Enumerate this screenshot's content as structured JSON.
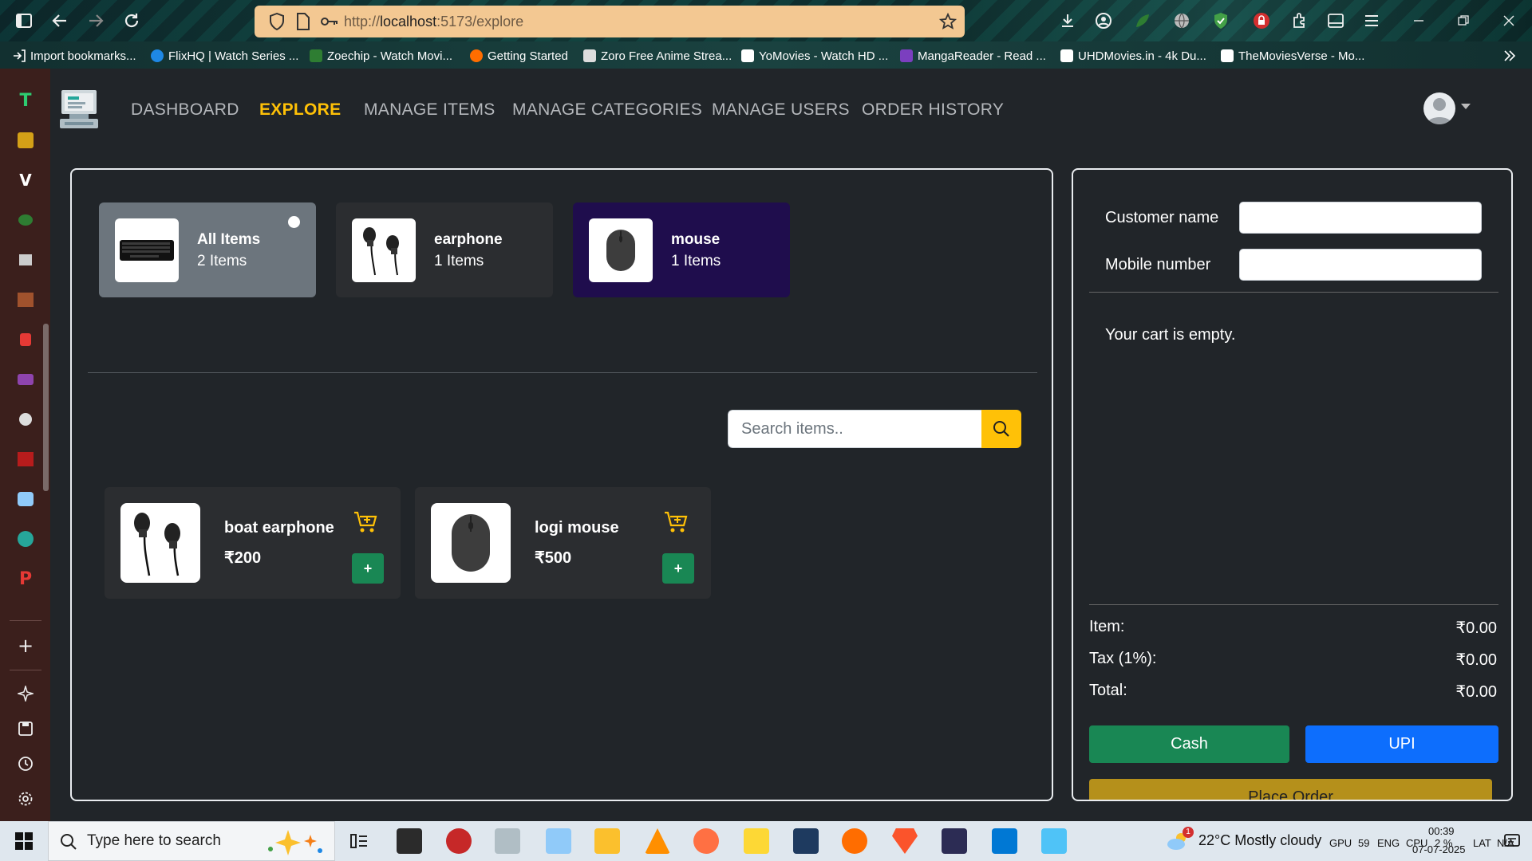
{
  "browser": {
    "url_prefix": "http://",
    "url_host": "localhost",
    "url_rest": ":5173/explore",
    "bookmarks": [
      "Import bookmarks...",
      "FlixHQ | Watch Series ...",
      "Zoechip - Watch Movi...",
      "Getting Started",
      "Zoro Free Anime Strea...",
      "YoMovies - Watch HD ...",
      "MangaReader - Read ...",
      "UHDMovies.in - 4k Du...",
      "TheMoviesVerse - Mo..."
    ]
  },
  "nav": {
    "links": [
      "DASHBOARD",
      "EXPLORE",
      "MANAGE ITEMS",
      "MANAGE CATEGORIES",
      "MANAGE USERS",
      "ORDER HISTORY"
    ],
    "active": "EXPLORE"
  },
  "categories": [
    {
      "name": "All Items",
      "count": "2 Items",
      "selected": true
    },
    {
      "name": "earphone",
      "count": "1 Items"
    },
    {
      "name": "mouse",
      "count": "1 Items"
    }
  ],
  "search": {
    "placeholder": "Search items.."
  },
  "items": [
    {
      "name": "boat earphone",
      "price": "₹200"
    },
    {
      "name": "logi mouse",
      "price": "₹500"
    }
  ],
  "cart": {
    "customer_label": "Customer name",
    "mobile_label": "Mobile number",
    "empty_text": "Your cart is empty.",
    "item_label": "Item:",
    "item_value": "₹0.00",
    "tax_label": "Tax (1%):",
    "tax_value": "₹0.00",
    "total_label": "Total:",
    "total_value": "₹0.00",
    "cash_label": "Cash",
    "upi_label": "UPI",
    "place_order_label": "Place Order"
  },
  "taskbar": {
    "search_placeholder": "Type here to search",
    "weather": "22°C  Mostly cloudy",
    "gpu": "GPU",
    "gpu_val": "59",
    "lang": "ENG",
    "cpu": "CPU",
    "cpu_val": "2 %",
    "time": "00:39",
    "date": "07-07-2025",
    "lat": "LAT",
    "lat_val": "N/A",
    "weather_badge": "1"
  },
  "colors": {
    "accent": "#ffc107",
    "cash": "#198754",
    "upi": "#0d6efd",
    "place_order": "#b5901b",
    "cat_all_bg": "#6c757d",
    "cat_mouse_bg": "#1f0d4d"
  }
}
